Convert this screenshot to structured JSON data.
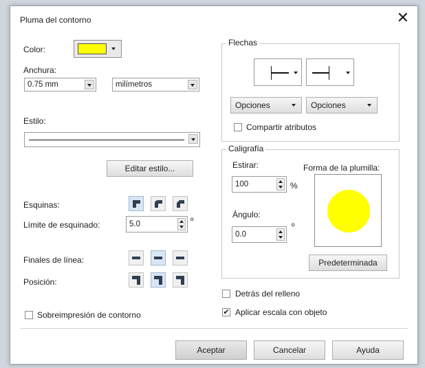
{
  "dialog": {
    "title": "Pluma del contorno",
    "close_glyph": "✕"
  },
  "left": {
    "color_label": "Color:",
    "color_value": "#ffff00",
    "width_label": "Anchura:",
    "width_value": "0.75 mm",
    "unit_value": "milímetros",
    "style_label": "Estilo:",
    "edit_style_button": "Editar estilo...",
    "corners_label": "Esquinas:",
    "miter_label": "Límite de esquinado:",
    "miter_value": "5.0",
    "miter_unit": "º",
    "line_caps_label": "Finales de línea:",
    "position_label": "Posición:",
    "overprint_label": "Sobreimpresión de contorno",
    "overprint_checked": false
  },
  "arrows": {
    "group_title": "Flechas",
    "options_left": "Opciones",
    "options_right": "Opciones",
    "share_label": "Compartir atributos",
    "share_checked": false
  },
  "calligraphy": {
    "group_title": "Caligrafía",
    "stretch_label": "Estirar:",
    "stretch_value": "100",
    "stretch_unit": "%",
    "angle_label": "Ángulo:",
    "angle_value": "0.0",
    "angle_unit": "º",
    "nib_label": "Forma de la plumilla:",
    "nib_color": "#ffff00",
    "default_button": "Predeterminada"
  },
  "bottom_options": {
    "behind_fill_label": "Detrás del relleno",
    "behind_fill_checked": false,
    "scale_label": "Aplicar escala con objeto",
    "scale_checked": true
  },
  "footer": {
    "ok_label": "Aceptar",
    "cancel_label": "Cancelar",
    "help_label": "Ayuda"
  }
}
